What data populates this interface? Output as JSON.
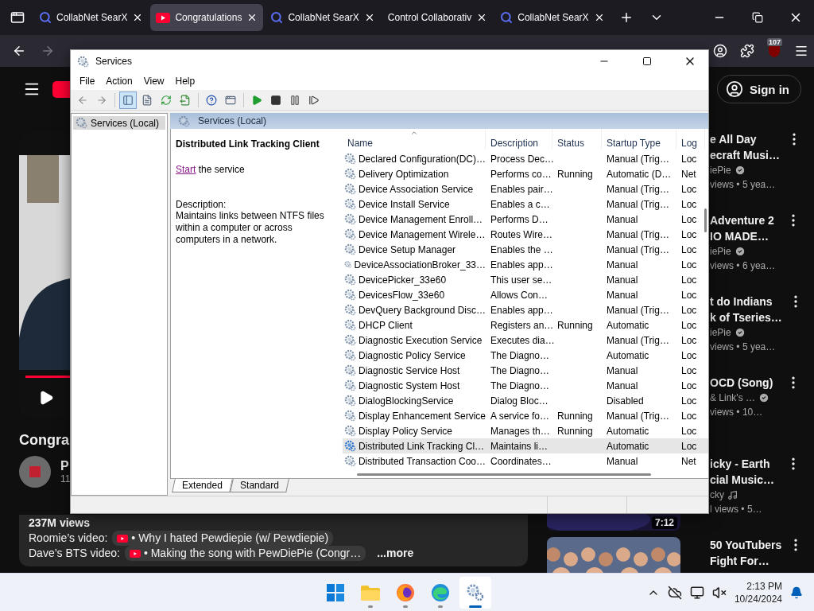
{
  "browser": {
    "tabs": [
      {
        "title": "CollabNet SearX",
        "kind": "search",
        "selected": false
      },
      {
        "title": "Congratulations",
        "kind": "video",
        "selected": true
      },
      {
        "title": "CollabNet SearX",
        "kind": "search",
        "selected": false
      },
      {
        "title": "Control Collaborativ",
        "kind": "plain",
        "selected": false
      },
      {
        "title": "CollabNet SearX",
        "kind": "search",
        "selected": false
      }
    ],
    "extension_badge": "107"
  },
  "youtube": {
    "sign_in": "Sign in",
    "video_title": "Congra",
    "channel_name": "P",
    "channel_subs": "11",
    "description": {
      "stats": "237M views",
      "links": [
        {
          "label": "Roomie’s video:",
          "chip": "• Why I hated Pewdiepie (w/ Pewdiepie)"
        },
        {
          "label": "Dave’s BTS video:",
          "chip": "• Making the song with PewDiePie (Congr…"
        }
      ],
      "more": "...more"
    },
    "recommendations": [
      {
        "title": [
          "e All Day",
          "ecraft Musi…"
        ],
        "channel": "iePie",
        "kind": "verified",
        "meta": "views  • 5 yea…"
      },
      {
        "title": [
          "Adventure 2",
          "IO MADE…"
        ],
        "channel": "iePie",
        "kind": "verified",
        "meta": "views  • 6 yea…"
      },
      {
        "title": [
          "t do Indians",
          "k of Tseries…"
        ],
        "channel": "iePie",
        "kind": "verified",
        "meta": "views  • 5 yea…"
      },
      {
        "title": [
          "OCD (Song)"
        ],
        "channel": "& Link's …",
        "kind": "verified",
        "meta": "views  • 10…"
      },
      {
        "title": [
          "icky - Earth",
          "cial Music…"
        ],
        "channel": "cky",
        "kind": "music",
        "meta": "l views  • 5…",
        "duration": "7:12"
      },
      {
        "title": [
          "50 YouTubers",
          "Fight For…"
        ]
      }
    ]
  },
  "services": {
    "title": "Services",
    "menu": [
      "File",
      "Action",
      "View",
      "Help"
    ],
    "toolbar": [
      {
        "kind": "back",
        "selected": false
      },
      {
        "kind": "forward",
        "selected": false
      },
      {
        "kind": "tree",
        "selected": true
      },
      {
        "kind": "properties",
        "selected": false
      },
      {
        "kind": "refresh",
        "selected": false
      },
      {
        "kind": "export",
        "selected": false
      },
      {
        "kind": "help",
        "selected": false
      },
      {
        "kind": "view",
        "selected": false
      },
      {
        "kind": "start",
        "selected": false
      },
      {
        "kind": "stop",
        "selected": false
      },
      {
        "kind": "pause",
        "selected": false
      },
      {
        "kind": "restart",
        "selected": false
      }
    ],
    "tree": [
      {
        "label": "Services (Local)",
        "selected": true
      }
    ],
    "header": "Services (Local)",
    "detail": {
      "title": "Distributed Link Tracking Client",
      "link": "Start",
      "link_rest": "the service",
      "description_label": "Description:",
      "description": "Maintains links between NTFS files within a computer or across computers in a network."
    },
    "table": {
      "columns": [
        {
          "label": "Name",
          "sorted": true
        },
        {
          "label": "Description",
          "sorted": false
        },
        {
          "label": "Status",
          "sorted": false
        },
        {
          "label": "Startup Type",
          "sorted": false
        },
        {
          "label": "Log",
          "sorted": false
        }
      ],
      "rows": [
        {
          "name": "Declared Configuration(DC)…",
          "description": "Process Dec…",
          "startup": "Manual (Trig…",
          "log": "Loc",
          "selected": false
        },
        {
          "name": "Delivery Optimization",
          "description": "Performs co…",
          "status": "Running",
          "startup": "Automatic (D…",
          "log": "Net",
          "selected": false
        },
        {
          "name": "Device Association Service",
          "description": "Enables pair…",
          "startup": "Manual (Trig…",
          "log": "Loc",
          "selected": false
        },
        {
          "name": "Device Install Service",
          "description": "Enables a c…",
          "startup": "Manual (Trig…",
          "log": "Loc",
          "selected": false
        },
        {
          "name": "Device Management Enroll…",
          "description": "Performs D…",
          "startup": "Manual",
          "log": "Loc",
          "selected": false
        },
        {
          "name": "Device Management Wirele…",
          "description": "Routes Wire…",
          "startup": "Manual (Trig…",
          "log": "Loc",
          "selected": false
        },
        {
          "name": "Device Setup Manager",
          "description": "Enables the …",
          "startup": "Manual (Trig…",
          "log": "Loc",
          "selected": false
        },
        {
          "name": "DeviceAssociationBroker_33…",
          "description": "Enables app…",
          "startup": "Manual",
          "log": "Loc",
          "selected": false
        },
        {
          "name": "DevicePicker_33e60",
          "description": "This user se…",
          "startup": "Manual",
          "log": "Loc",
          "selected": false
        },
        {
          "name": "DevicesFlow_33e60",
          "description": "Allows Con…",
          "startup": "Manual",
          "log": "Loc",
          "selected": false
        },
        {
          "name": "DevQuery Background Disc…",
          "description": "Enables app…",
          "startup": "Manual (Trig…",
          "log": "Loc",
          "selected": false
        },
        {
          "name": "DHCP Client",
          "description": "Registers an…",
          "status": "Running",
          "startup": "Automatic",
          "log": "Loc",
          "selected": false
        },
        {
          "name": "Diagnostic Execution Service",
          "description": "Executes dia…",
          "startup": "Manual (Trig…",
          "log": "Loc",
          "selected": false
        },
        {
          "name": "Diagnostic Policy Service",
          "description": "The Diagno…",
          "startup": "Automatic",
          "log": "Loc",
          "selected": false
        },
        {
          "name": "Diagnostic Service Host",
          "description": "The Diagno…",
          "startup": "Manual",
          "log": "Loc",
          "selected": false
        },
        {
          "name": "Diagnostic System Host",
          "description": "The Diagno…",
          "startup": "Manual",
          "log": "Loc",
          "selected": false
        },
        {
          "name": "DialogBlockingService",
          "description": "Dialog Bloc…",
          "startup": "Disabled",
          "log": "Loc",
          "selected": false
        },
        {
          "name": "Display Enhancement Service",
          "description": "A service fo…",
          "status": "Running",
          "startup": "Manual (Trig…",
          "log": "Loc",
          "selected": false
        },
        {
          "name": "Display Policy Service",
          "description": "Manages th…",
          "status": "Running",
          "startup": "Automatic",
          "log": "Loc",
          "selected": false
        },
        {
          "name": "Distributed Link Tracking Cl…",
          "description": "Maintains li…",
          "startup": "Automatic",
          "log": "Loc",
          "selected": true
        },
        {
          "name": "Distributed Transaction Coo…",
          "description": "Coordinates…",
          "startup": "Manual",
          "log": "Net",
          "selected": false
        }
      ]
    },
    "view_tabs": [
      {
        "label": "Extended",
        "selected": true
      },
      {
        "label": "Standard",
        "selected": false
      }
    ]
  },
  "taskbar": {
    "apps": [
      {
        "kind": "start",
        "running": false,
        "active": false
      },
      {
        "kind": "files",
        "running": true,
        "active": false
      },
      {
        "kind": "firefox",
        "running": true,
        "active": false
      },
      {
        "kind": "edge",
        "running": true,
        "active": false
      },
      {
        "kind": "services",
        "running": true,
        "active": true
      }
    ],
    "time": "2:13 PM",
    "date": "10/24/2024"
  }
}
